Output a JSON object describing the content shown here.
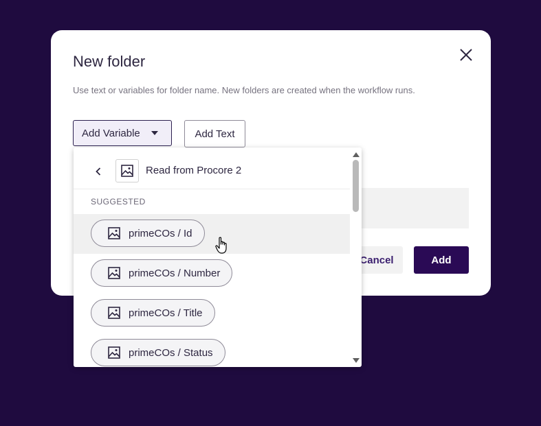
{
  "modal": {
    "title": "New folder",
    "description": "Use text or variables for folder name. New folders are created when the workflow runs.",
    "add_variable_label": "Add Variable",
    "add_text_label": "Add Text",
    "cancel_label": "Cancel",
    "add_label": "Add"
  },
  "dropdown": {
    "source_title": "Read from Procore 2",
    "section_label": "SUGGESTED",
    "items": [
      {
        "label": "primeCOs / Id",
        "icon": "image-icon"
      },
      {
        "label": "primeCOs / Number",
        "icon": "image-icon"
      },
      {
        "label": "primeCOs / Title",
        "icon": "image-icon"
      },
      {
        "label": "primeCOs / Status",
        "icon": "image-icon"
      }
    ]
  },
  "colors": {
    "backdrop": "#1f0b3f",
    "primary_button": "#2a0a55",
    "text": "#2d2640"
  }
}
